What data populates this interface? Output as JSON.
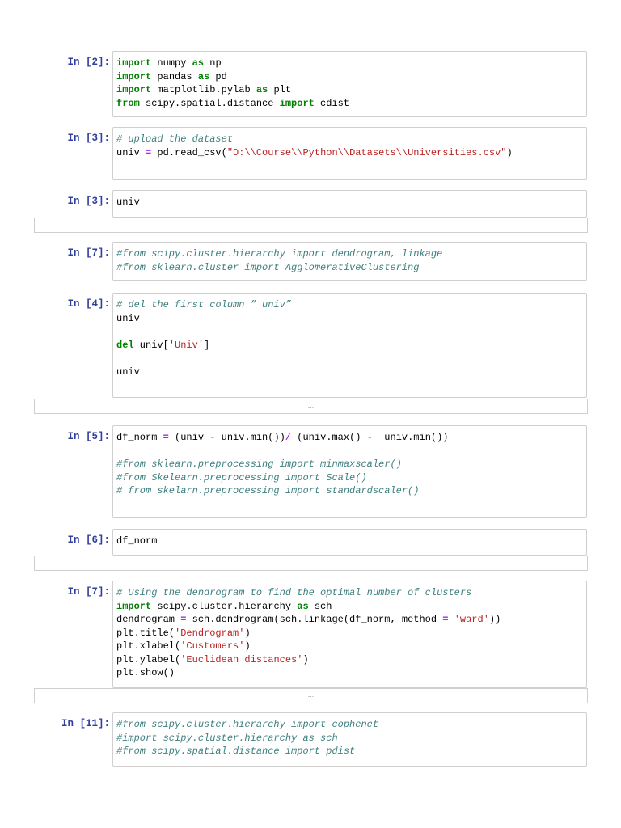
{
  "cells": [
    {
      "prompt": "In [2]:",
      "lines": [
        [
          [
            "import",
            "kw"
          ],
          [
            " numpy ",
            ""
          ],
          [
            "as",
            "kw"
          ],
          [
            " np",
            ""
          ]
        ],
        [
          [
            "import",
            "kw"
          ],
          [
            " pandas ",
            ""
          ],
          [
            "as",
            "kw"
          ],
          [
            " pd",
            ""
          ]
        ],
        [
          [
            "import",
            "kw"
          ],
          [
            " matplotlib.pylab ",
            ""
          ],
          [
            "as",
            "kw"
          ],
          [
            " plt",
            ""
          ]
        ],
        [
          [
            "from",
            "kw"
          ],
          [
            " scipy.spatial.distance ",
            ""
          ],
          [
            "import",
            "kw"
          ],
          [
            " cdist",
            ""
          ]
        ]
      ]
    },
    {
      "prompt": "In [3]:",
      "lines": [
        [
          [
            "# upload the dataset",
            "cm"
          ]
        ],
        [
          [
            "univ ",
            ""
          ],
          [
            "=",
            "op"
          ],
          [
            " pd.read_csv(",
            ""
          ],
          [
            "\"D:\\\\Course\\\\Python\\\\Datasets\\\\Universities.csv\"",
            "str"
          ],
          [
            ")",
            ""
          ]
        ]
      ]
    },
    {
      "prompt": "In [3]:",
      "lines": [
        [
          [
            "univ",
            ""
          ]
        ]
      ],
      "output": "..."
    },
    {
      "prompt": "In [7]:",
      "lines": [
        [
          [
            "#from scipy.cluster.hierarchy import dendrogram, linkage",
            "cm"
          ]
        ],
        [
          [
            "#from sklearn.cluster import AgglomerativeClustering",
            "cm"
          ]
        ]
      ]
    },
    {
      "prompt": "In [4]:",
      "lines": [
        [
          [
            "# del the first column ” univ”",
            "cm"
          ]
        ],
        [
          [
            "univ",
            ""
          ]
        ],
        [
          [
            "",
            ""
          ]
        ],
        [
          [
            "del",
            "kw"
          ],
          [
            " univ[",
            ""
          ],
          [
            "'Univ'",
            "str"
          ],
          [
            "]",
            ""
          ]
        ],
        [
          [
            "",
            ""
          ]
        ],
        [
          [
            "univ",
            ""
          ]
        ]
      ],
      "output": "..."
    },
    {
      "prompt": "In [5]:",
      "lines": [
        [
          [
            "df_norm ",
            ""
          ],
          [
            "=",
            "op"
          ],
          [
            " (univ ",
            ""
          ],
          [
            "-",
            "op"
          ],
          [
            " univ.min())",
            ""
          ],
          [
            "/",
            "op"
          ],
          [
            " (univ.max() ",
            ""
          ],
          [
            "-",
            "op"
          ],
          [
            "  univ.min())",
            ""
          ]
        ],
        [
          [
            "",
            ""
          ]
        ],
        [
          [
            "#from sklearn.preprocessing import minmaxscaler()",
            "cm"
          ]
        ],
        [
          [
            "#from Skelearn.preprocessing import Scale()",
            "cm"
          ]
        ],
        [
          [
            "# from skelarn.preprocessing import standardscaler()",
            "cm"
          ]
        ]
      ]
    },
    {
      "prompt": "In [6]:",
      "lines": [
        [
          [
            "df_norm",
            ""
          ]
        ]
      ],
      "output": "..."
    },
    {
      "prompt": "In [7]:",
      "lines": [
        [
          [
            "# Using the dendrogram to find the optimal number of clusters",
            "cm"
          ]
        ],
        [
          [
            "import",
            "kw"
          ],
          [
            " scipy.cluster.hierarchy ",
            ""
          ],
          [
            "as",
            "kw"
          ],
          [
            " sch",
            ""
          ]
        ],
        [
          [
            "dendrogram ",
            ""
          ],
          [
            "=",
            "op"
          ],
          [
            " sch.dendrogram(sch.linkage(df_norm, method ",
            ""
          ],
          [
            "=",
            "op"
          ],
          [
            " ",
            ""
          ],
          [
            "'ward'",
            "str"
          ],
          [
            "))",
            ""
          ]
        ],
        [
          [
            "plt.title(",
            ""
          ],
          [
            "'Dendrogram'",
            "str"
          ],
          [
            ")",
            ""
          ]
        ],
        [
          [
            "plt.xlabel(",
            ""
          ],
          [
            "'Customers'",
            "str"
          ],
          [
            ")",
            ""
          ]
        ],
        [
          [
            "plt.ylabel(",
            ""
          ],
          [
            "'Euclidean distances'",
            "str"
          ],
          [
            ")",
            ""
          ]
        ],
        [
          [
            "plt.show()",
            ""
          ]
        ]
      ],
      "output": "..."
    },
    {
      "prompt": "In [11]:",
      "lines": [
        [
          [
            "#from scipy.cluster.hierarchy import cophenet",
            "cm"
          ]
        ],
        [
          [
            "#import scipy.cluster.hierarchy as sch",
            "cm"
          ]
        ],
        [
          [
            "#from scipy.spatial.distance import pdist",
            "cm"
          ]
        ]
      ]
    }
  ],
  "colors": {
    "prompt": "#303f9f",
    "keyword": "#008000",
    "string": "#ba2121",
    "comment": "#408080"
  }
}
